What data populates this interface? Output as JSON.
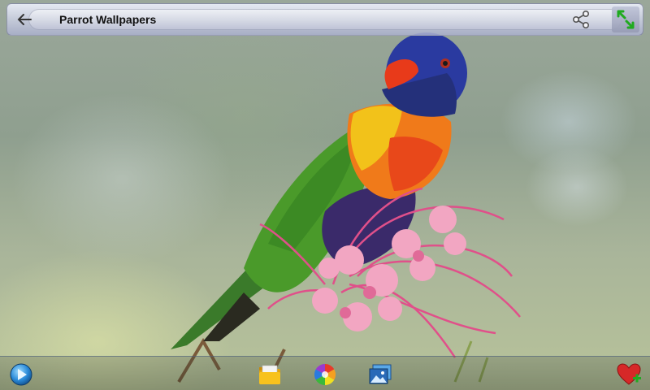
{
  "app": {
    "title": "Parrot Wallpapers"
  },
  "topbar": {
    "back_icon": "arrow-left-icon",
    "share_icon": "share-icon",
    "fullscreen_icon": "expand-arrows-icon"
  },
  "wallpaper": {
    "subject": "rainbow lorikeet on pink grevillea flower"
  },
  "bottombar": {
    "items": [
      {
        "icon": "play-slideshow-icon"
      },
      {
        "icon": "folder-icon"
      },
      {
        "icon": "color-wheel-icon"
      },
      {
        "icon": "set-wallpaper-icon"
      },
      {
        "icon": "favorite-heart-add-icon"
      }
    ]
  },
  "colors": {
    "title_text": "#111111",
    "accent_green": "#22aa22",
    "heart_red": "#d62828"
  }
}
